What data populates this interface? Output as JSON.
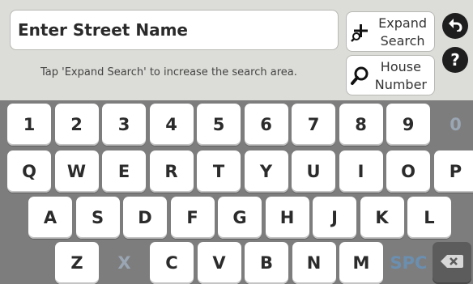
{
  "search": {
    "label": "Enter Street Name"
  },
  "hint": "Tap 'Expand Search' to increase the search area.",
  "buttons": {
    "expand_line1": "Expand",
    "expand_line2": "Search",
    "house_line1": "House",
    "house_line2": "Number",
    "back_icon": "back-arrow-icon",
    "help_label": "?"
  },
  "keyboard": {
    "row1": [
      "1",
      "2",
      "3",
      "4",
      "5",
      "6",
      "7",
      "8",
      "9",
      "0"
    ],
    "row2": [
      "Q",
      "W",
      "E",
      "R",
      "T",
      "Y",
      "U",
      "I",
      "O",
      "P"
    ],
    "row3": [
      "A",
      "S",
      "D",
      "F",
      "G",
      "H",
      "J",
      "K",
      "L"
    ],
    "row4": [
      "Z",
      "X",
      "C",
      "V",
      "B",
      "N",
      "M"
    ],
    "space_label": "SPC",
    "delete_icon": "backspace-icon",
    "disabled_keys": [
      "0",
      "X",
      "SPC"
    ]
  },
  "colors": {
    "keyboard_bg": "#7d7d7d",
    "disabled_key": "#9aa6b4",
    "accent_dark": "#1e1e1e"
  }
}
